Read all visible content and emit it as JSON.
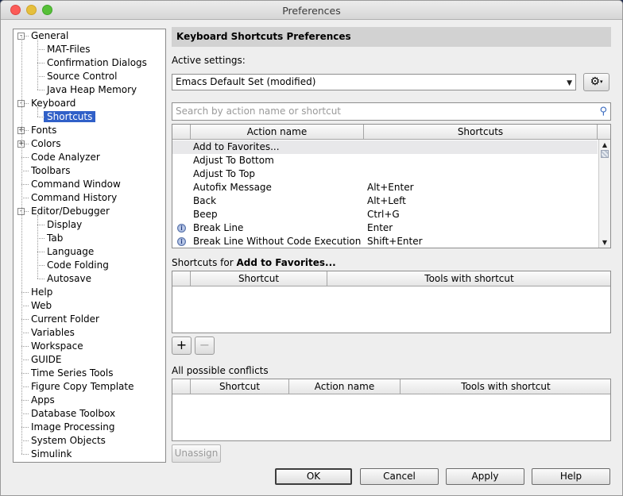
{
  "window": {
    "title": "Preferences"
  },
  "tree": [
    {
      "label": "General",
      "level": 0,
      "expander": "-"
    },
    {
      "label": "MAT-Files",
      "level": 1
    },
    {
      "label": "Confirmation Dialogs",
      "level": 1
    },
    {
      "label": "Source Control",
      "level": 1
    },
    {
      "label": "Java Heap Memory",
      "level": 1
    },
    {
      "label": "Keyboard",
      "level": 0,
      "expander": "-"
    },
    {
      "label": "Shortcuts",
      "level": 1,
      "selected": true
    },
    {
      "label": "Fonts",
      "level": 0,
      "expander": "+"
    },
    {
      "label": "Colors",
      "level": 0,
      "expander": "+"
    },
    {
      "label": "Code Analyzer",
      "level": 0
    },
    {
      "label": "Toolbars",
      "level": 0
    },
    {
      "label": "Command Window",
      "level": 0
    },
    {
      "label": "Command History",
      "level": 0
    },
    {
      "label": "Editor/Debugger",
      "level": 0,
      "expander": "-"
    },
    {
      "label": "Display",
      "level": 1
    },
    {
      "label": "Tab",
      "level": 1
    },
    {
      "label": "Language",
      "level": 1
    },
    {
      "label": "Code Folding",
      "level": 1
    },
    {
      "label": "Autosave",
      "level": 1
    },
    {
      "label": "Help",
      "level": 0
    },
    {
      "label": "Web",
      "level": 0
    },
    {
      "label": "Current Folder",
      "level": 0
    },
    {
      "label": "Variables",
      "level": 0
    },
    {
      "label": "Workspace",
      "level": 0
    },
    {
      "label": "GUIDE",
      "level": 0
    },
    {
      "label": "Time Series Tools",
      "level": 0
    },
    {
      "label": "Figure Copy Template",
      "level": 0
    },
    {
      "label": "Apps",
      "level": 0
    },
    {
      "label": "Database Toolbox",
      "level": 0
    },
    {
      "label": "Image Processing",
      "level": 0
    },
    {
      "label": "System Objects",
      "level": 0
    },
    {
      "label": "Simulink",
      "level": 0
    }
  ],
  "panel": {
    "header": "Keyboard Shortcuts Preferences",
    "active_settings_label": "Active settings:",
    "active_settings_value": "Emacs Default Set (modified)",
    "search_placeholder": "Search by action name or shortcut",
    "actions_table": {
      "columns": [
        "Action name",
        "Shortcuts"
      ],
      "rows": [
        {
          "action": "Add to Favorites...",
          "shortcut": "",
          "selected": true,
          "warn": false
        },
        {
          "action": "Adjust To Bottom",
          "shortcut": "",
          "warn": false
        },
        {
          "action": "Adjust To Top",
          "shortcut": "",
          "warn": false
        },
        {
          "action": "Autofix Message",
          "shortcut": "Alt+Enter",
          "warn": false
        },
        {
          "action": "Back",
          "shortcut": "Alt+Left",
          "warn": false
        },
        {
          "action": "Beep",
          "shortcut": "Ctrl+G",
          "warn": false
        },
        {
          "action": "Break Line",
          "shortcut": "Enter",
          "warn": true
        },
        {
          "action": "Break Line Without Code Execution",
          "shortcut": "Shift+Enter",
          "warn": true
        }
      ]
    },
    "shortcuts_for_prefix": "Shortcuts for ",
    "shortcuts_for_action": "Add to Favorites...",
    "shortcuts_table": {
      "columns": [
        "Shortcut",
        "Tools with shortcut"
      ]
    },
    "add_symbol": "+",
    "remove_symbol": "−",
    "conflicts_label": "All possible conflicts",
    "conflicts_table": {
      "columns": [
        "Shortcut",
        "Action name",
        "Tools with shortcut"
      ]
    },
    "unassign_label": "Unassign"
  },
  "buttons": {
    "ok": "OK",
    "cancel": "Cancel",
    "apply": "Apply",
    "help": "Help"
  },
  "icons": {
    "gear": "gear-icon",
    "search": "search-icon",
    "warn": "info-warning-icon"
  }
}
